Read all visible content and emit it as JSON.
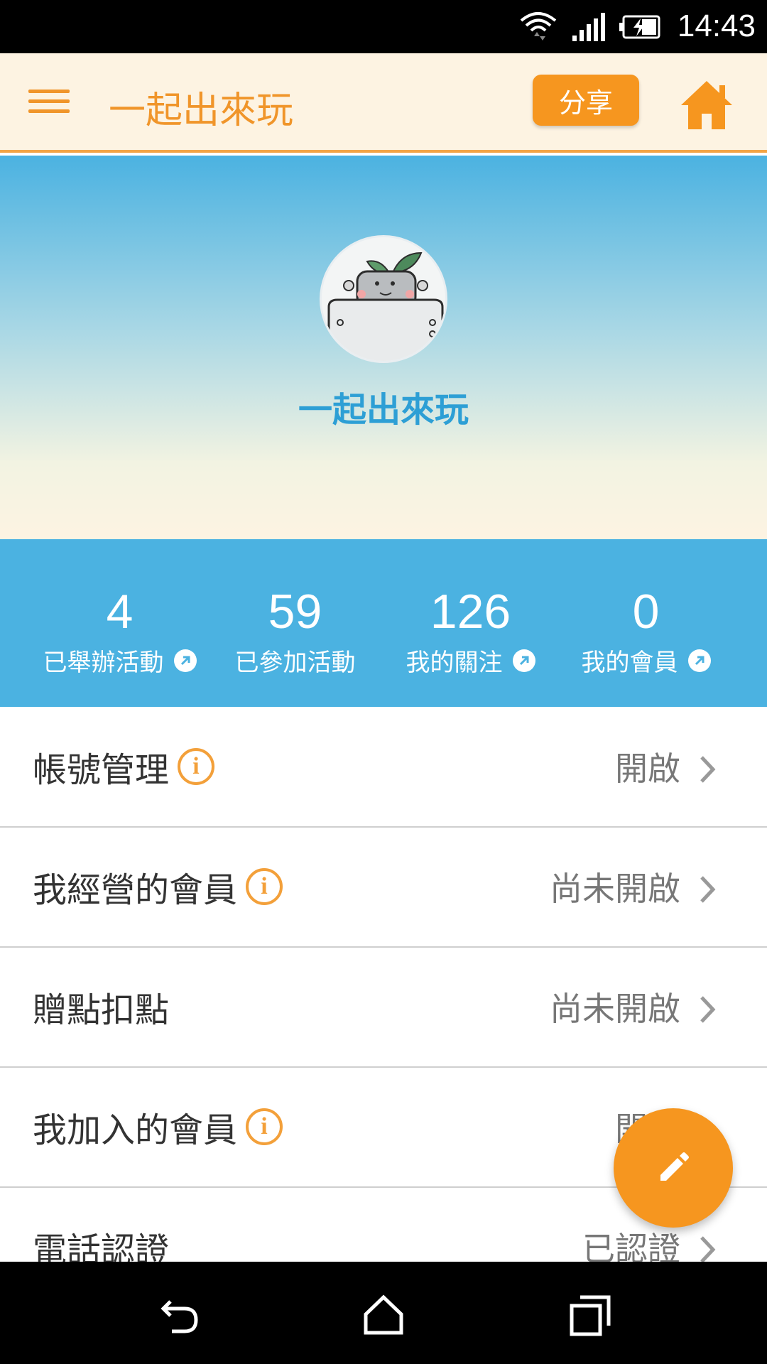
{
  "status_bar": {
    "time": "14:43"
  },
  "header": {
    "title": "一起出來玩",
    "share_label": "分享"
  },
  "profile": {
    "name": "一起出來玩"
  },
  "stats": [
    {
      "value": "4",
      "label": "已舉辦活動",
      "link": true
    },
    {
      "value": "59",
      "label": "已參加活動",
      "link": false
    },
    {
      "value": "126",
      "label": "我的關注",
      "link": true
    },
    {
      "value": "0",
      "label": "我的會員",
      "link": true
    }
  ],
  "settings": [
    {
      "label": "帳號管理",
      "info": true,
      "value": "開啟"
    },
    {
      "label": "我經營的會員",
      "info": true,
      "value": "尚未開啟"
    },
    {
      "label": "贈點扣點",
      "info": false,
      "value": "尚未開啟"
    },
    {
      "label": "我加入的會員",
      "info": true,
      "value": "開啟"
    },
    {
      "label": "電話認證",
      "info": false,
      "value": "已認證"
    }
  ],
  "info_glyph": "i",
  "colors": {
    "accent": "#f6961f",
    "sky": "#4bb2e1",
    "header_bg": "#fdf3e2"
  }
}
